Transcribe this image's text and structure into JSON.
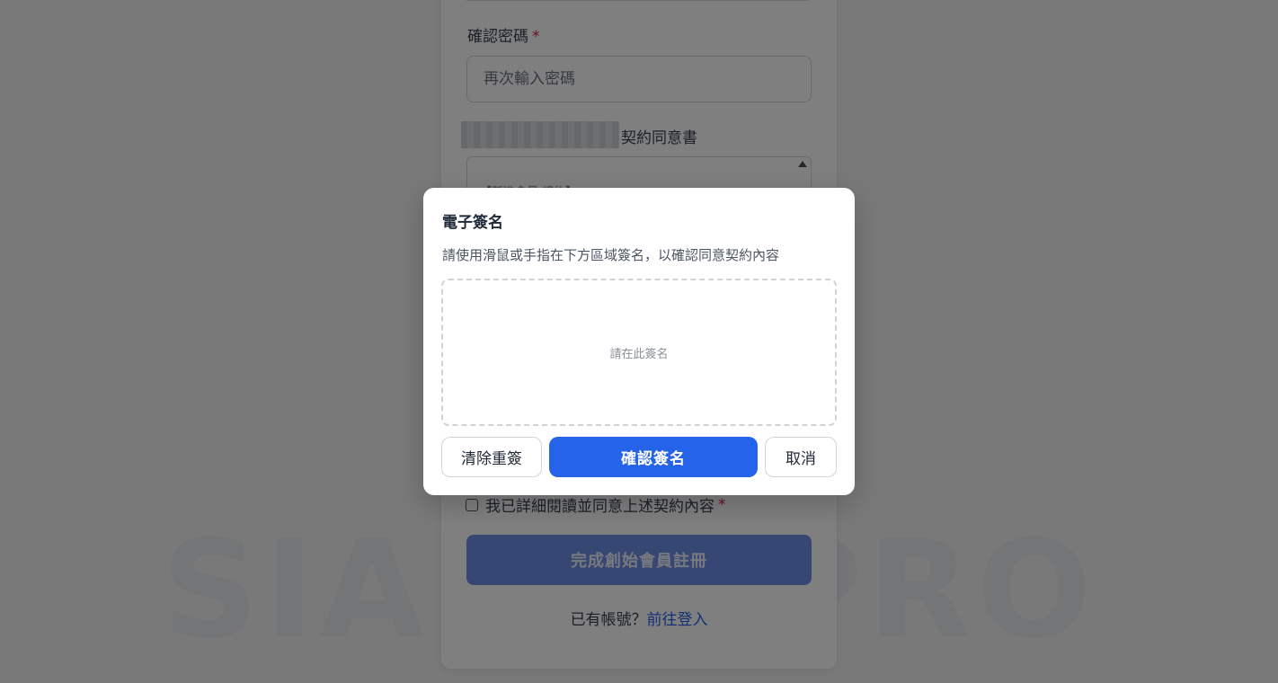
{
  "background": {
    "watermark": "SIANNTPRO",
    "confirm_password": {
      "label": "確認密碼",
      "required_mark": "*",
      "placeholder": "再次輸入密碼"
    },
    "agreement": {
      "title": "契約同意書",
      "text_preview": "【新進會員 規約】"
    },
    "agree_checkbox": {
      "label": "我已詳細閱讀並同意上述契約內容",
      "required_mark": "*"
    },
    "submit_button": "完成創始會員註冊",
    "login_prompt": {
      "text": "已有帳號？",
      "link": "前往登入"
    }
  },
  "modal": {
    "title": "電子簽名",
    "description": "請使用滑鼠或手指在下方區域簽名，以確認同意契約內容",
    "pad_hint": "請在此簽名",
    "buttons": {
      "clear": "清除重簽",
      "confirm": "確認簽名",
      "cancel": "取消"
    }
  },
  "colors": {
    "primary": "#2563eb",
    "required": "#e11d48",
    "overlay": "rgba(0,0,0,0.5)"
  }
}
